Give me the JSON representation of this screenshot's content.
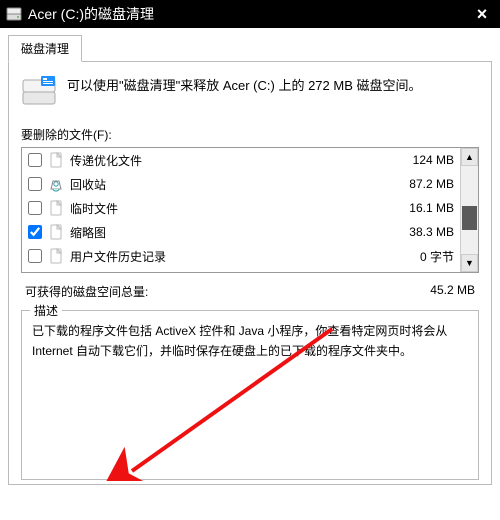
{
  "window": {
    "title": "Acer (C:)的磁盘清理"
  },
  "tab": {
    "label": "磁盘清理"
  },
  "intro": {
    "text": "可以使用\"磁盘清理\"来释放 Acer (C:) 上的 272 MB 磁盘空间。"
  },
  "labels": {
    "files_to_delete": "要删除的文件(F):",
    "total_gain_label": "可获得的磁盘空间总量:",
    "description_legend": "描述"
  },
  "files": [
    {
      "name": "传递优化文件",
      "size": "124 MB",
      "checked": false,
      "icon": "file"
    },
    {
      "name": "回收站",
      "size": "87.2 MB",
      "checked": false,
      "icon": "recycle"
    },
    {
      "name": "临时文件",
      "size": "16.1 MB",
      "checked": false,
      "icon": "file"
    },
    {
      "name": "缩略图",
      "size": "38.3 MB",
      "checked": true,
      "icon": "file"
    },
    {
      "name": "用户文件历史记录",
      "size": "0 字节",
      "checked": false,
      "icon": "file"
    }
  ],
  "totals": {
    "gain_value": "45.2 MB"
  },
  "description": {
    "text": "已下载的程序文件包括 ActiveX 控件和 Java 小程序，你查看特定网页时将会从 Internet 自动下载它们，并临时保存在硬盘上的已下载的程序文件夹中。"
  },
  "arrow": {
    "color": "#e11"
  }
}
